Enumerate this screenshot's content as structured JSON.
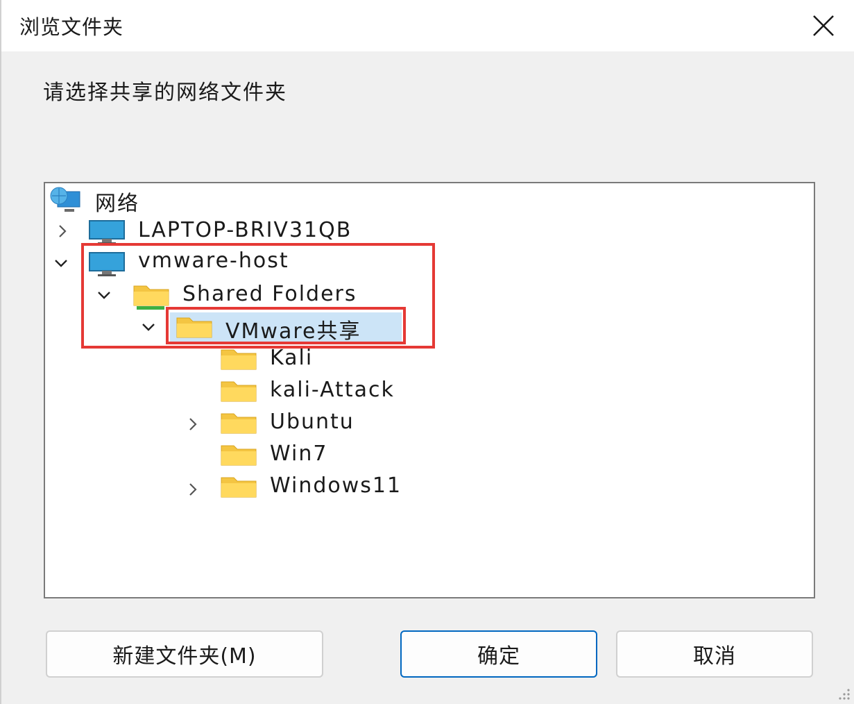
{
  "window": {
    "title": "浏览文件夹"
  },
  "prompt": "请选择共享的网络文件夹",
  "tree": {
    "root": {
      "label": "网络",
      "icon": "network-icon",
      "expanded": true
    },
    "items": [
      {
        "label": "LAPTOP-BRIV31QB",
        "icon": "computer-icon",
        "chevron": "collapsed"
      },
      {
        "label": "vmware-host",
        "icon": "computer-icon",
        "chevron": "expanded"
      },
      {
        "label": "Shared Folders",
        "icon": "shared-folder-icon",
        "chevron": "expanded"
      },
      {
        "label": "VMware共享",
        "icon": "folder-icon",
        "chevron": "expanded",
        "selected": true
      },
      {
        "label": "Kali",
        "icon": "folder-icon",
        "chevron": "none"
      },
      {
        "label": "kali-Attack",
        "icon": "folder-icon",
        "chevron": "none"
      },
      {
        "label": "Ubuntu",
        "icon": "folder-icon",
        "chevron": "collapsed"
      },
      {
        "label": "Win7",
        "icon": "folder-icon",
        "chevron": "none"
      },
      {
        "label": "Windows11",
        "icon": "folder-icon",
        "chevron": "collapsed"
      }
    ]
  },
  "buttons": {
    "new_folder": "新建文件夹(M)",
    "ok": "确定",
    "cancel": "取消"
  },
  "colors": {
    "highlight_box": "#e53935",
    "selection": "#cce4f7",
    "primary_border": "#0067c0",
    "folder": "#f7c948"
  }
}
